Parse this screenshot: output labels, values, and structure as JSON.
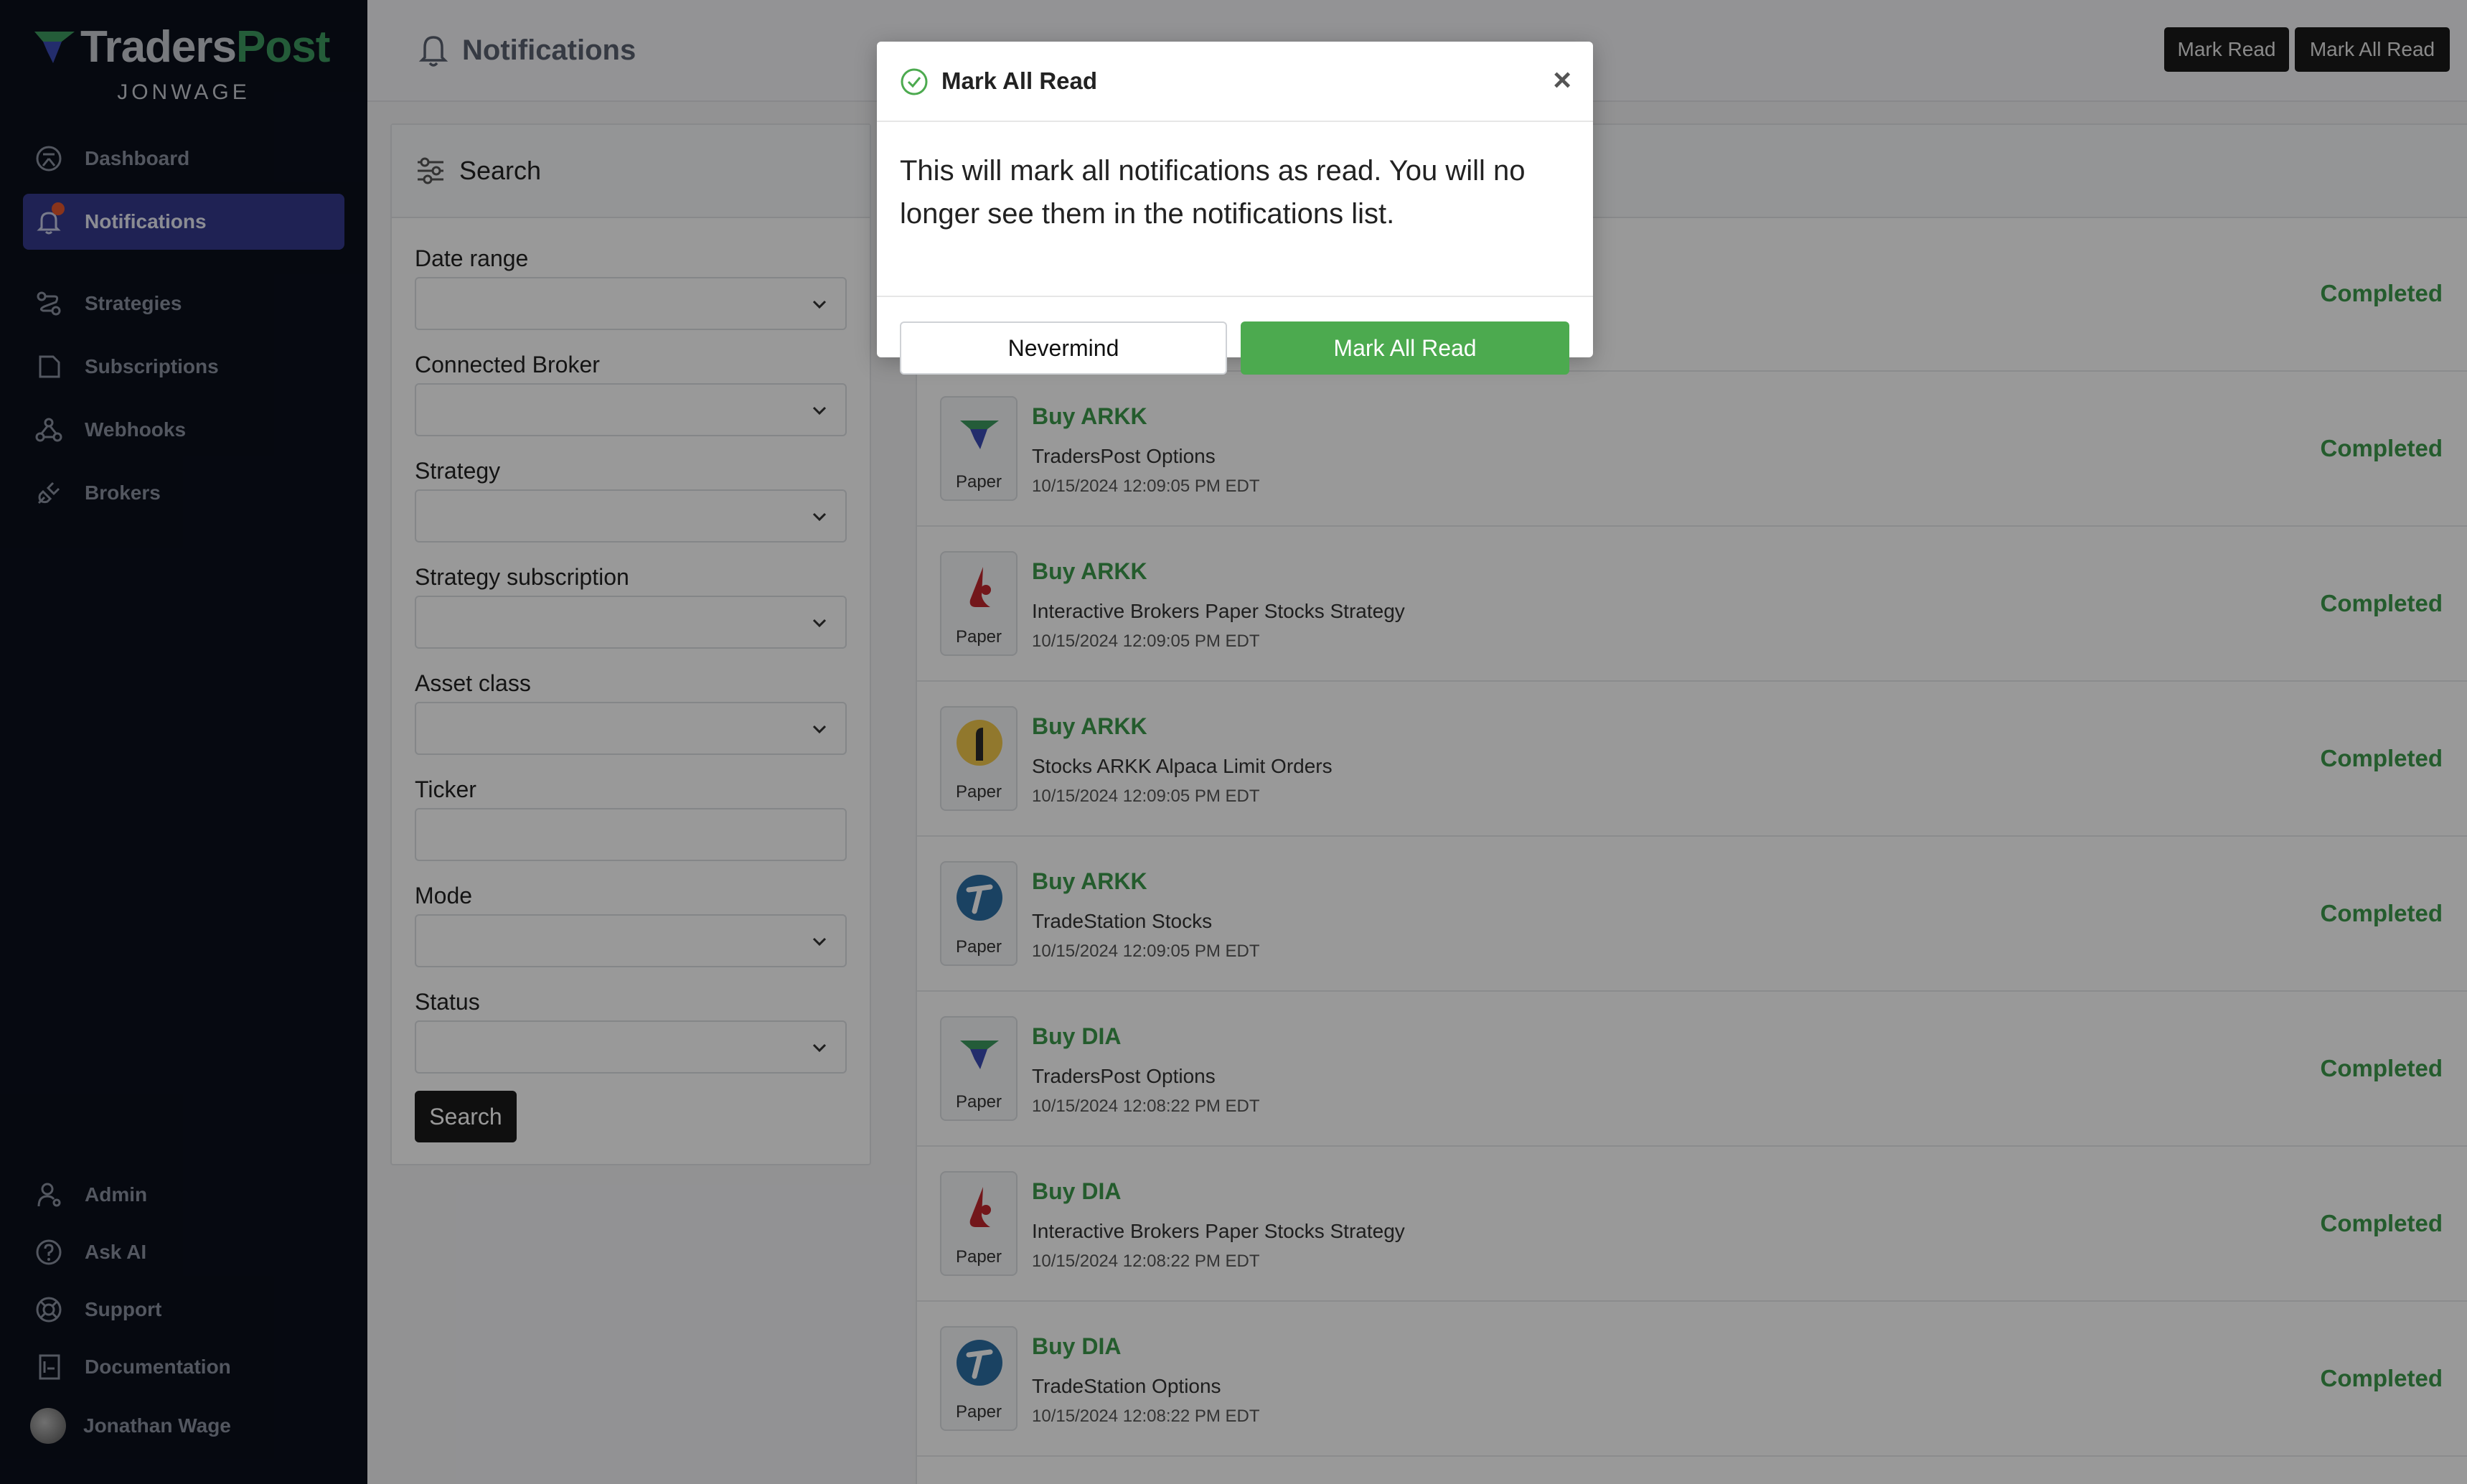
{
  "app": {
    "logo_part1": "Traders",
    "logo_part2": "Post",
    "org": "JONWAGE"
  },
  "sidebar": {
    "items": [
      {
        "label": "Dashboard",
        "icon": "dashboard-icon"
      },
      {
        "label": "Notifications",
        "icon": "bell-icon",
        "active": true
      },
      {
        "label": "Strategies",
        "icon": "strategy-icon"
      },
      {
        "label": "Subscriptions",
        "icon": "subscription-icon"
      },
      {
        "label": "Webhooks",
        "icon": "webhook-icon"
      },
      {
        "label": "Brokers",
        "icon": "plug-icon"
      }
    ],
    "bottom": [
      {
        "label": "Admin",
        "icon": "admin-icon"
      },
      {
        "label": "Ask AI",
        "icon": "help-icon"
      },
      {
        "label": "Support",
        "icon": "lifebuoy-icon"
      },
      {
        "label": "Documentation",
        "icon": "book-icon"
      },
      {
        "label": "Jonathan Wage",
        "icon": "avatar"
      }
    ]
  },
  "header": {
    "title": "Notifications",
    "mark_read": "Mark Read",
    "mark_all_read": "Mark All Read"
  },
  "search": {
    "title": "Search",
    "fields": [
      {
        "label": "Date range",
        "type": "select",
        "value": ""
      },
      {
        "label": "Connected Broker",
        "type": "select",
        "value": ""
      },
      {
        "label": "Strategy",
        "type": "select",
        "value": ""
      },
      {
        "label": "Strategy subscription",
        "type": "select",
        "value": ""
      },
      {
        "label": "Asset class",
        "type": "select",
        "value": ""
      },
      {
        "label": "Ticker",
        "type": "text",
        "value": ""
      },
      {
        "label": "Mode",
        "type": "select",
        "value": ""
      },
      {
        "label": "Status",
        "type": "select",
        "value": ""
      }
    ],
    "button": "Search"
  },
  "notifications": [
    {
      "title": "",
      "strategy": "",
      "time": "",
      "status": "Completed",
      "broker": "",
      "mode": ""
    },
    {
      "title": "Buy ARKK",
      "strategy": "TradersPost Options",
      "time": "10/15/2024 12:09:05 PM EDT",
      "status": "Completed",
      "broker": "traderspost",
      "mode": "Paper"
    },
    {
      "title": "Buy ARKK",
      "strategy": "Interactive Brokers Paper Stocks Strategy",
      "time": "10/15/2024 12:09:05 PM EDT",
      "status": "Completed",
      "broker": "interactive-brokers",
      "mode": "Paper"
    },
    {
      "title": "Buy ARKK",
      "strategy": "Stocks ARKK Alpaca Limit Orders",
      "time": "10/15/2024 12:09:05 PM EDT",
      "status": "Completed",
      "broker": "alpaca",
      "mode": "Paper"
    },
    {
      "title": "Buy ARKK",
      "strategy": "TradeStation Stocks",
      "time": "10/15/2024 12:09:05 PM EDT",
      "status": "Completed",
      "broker": "tradestation",
      "mode": "Paper"
    },
    {
      "title": "Buy DIA",
      "strategy": "TradersPost Options",
      "time": "10/15/2024 12:08:22 PM EDT",
      "status": "Completed",
      "broker": "traderspost",
      "mode": "Paper"
    },
    {
      "title": "Buy DIA",
      "strategy": "Interactive Brokers Paper Stocks Strategy",
      "time": "10/15/2024 12:08:22 PM EDT",
      "status": "Completed",
      "broker": "interactive-brokers",
      "mode": "Paper"
    },
    {
      "title": "Buy DIA",
      "strategy": "TradeStation Options",
      "time": "10/15/2024 12:08:22 PM EDT",
      "status": "Completed",
      "broker": "tradestation",
      "mode": "Paper"
    }
  ],
  "modal": {
    "title": "Mark All Read",
    "body": "This will mark all notifications as read. You will no longer see them in the notifications list.",
    "cancel": "Nevermind",
    "confirm": "Mark All Read"
  },
  "colors": {
    "sidebar_bg": "#0a0f1c",
    "active_nav": "#343a8c",
    "success_green": "#3c9a4c",
    "confirm_button": "#4caa4f"
  }
}
